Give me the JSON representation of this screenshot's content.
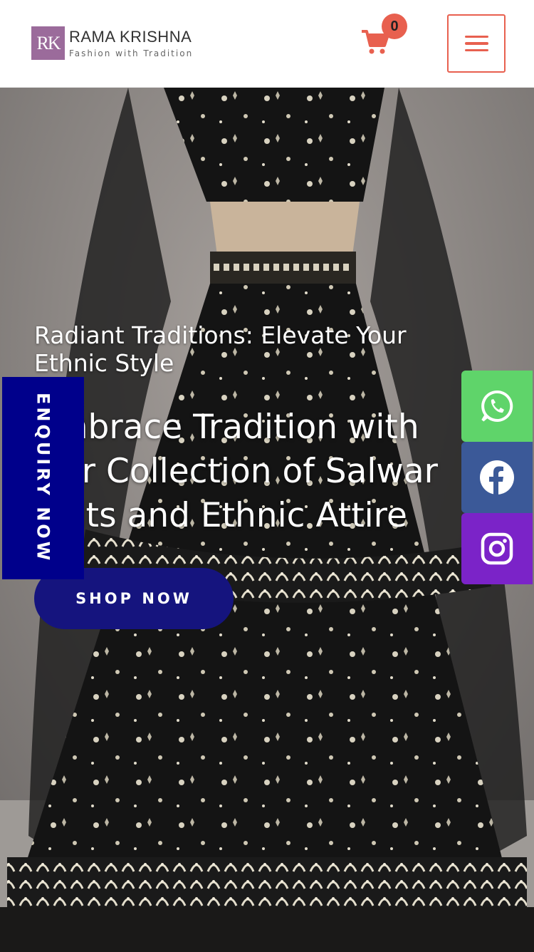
{
  "header": {
    "logo_mark": "RK",
    "brand_name": "RAMA KRISHNA",
    "brand_tagline": "Fashion with Tradition",
    "cart_count": "0",
    "accent_color": "#e8604f"
  },
  "hero": {
    "subtitle": "Radiant Traditions: Elevate Your Ethnic Style",
    "headline": "Embrace Tradition with Our Collection of Salwar Suits and Ethnic Attire",
    "cta_label": "SHOP NOW",
    "cta_color": "#15147e"
  },
  "enquiry": {
    "label": "ENQUIRY NOW",
    "color": "#00008b"
  },
  "social": [
    {
      "icon": "whatsapp-icon",
      "color": "#5fd46a"
    },
    {
      "icon": "facebook-icon",
      "color": "#3b5998"
    },
    {
      "icon": "instagram-icon",
      "color": "#7b23c8"
    }
  ]
}
